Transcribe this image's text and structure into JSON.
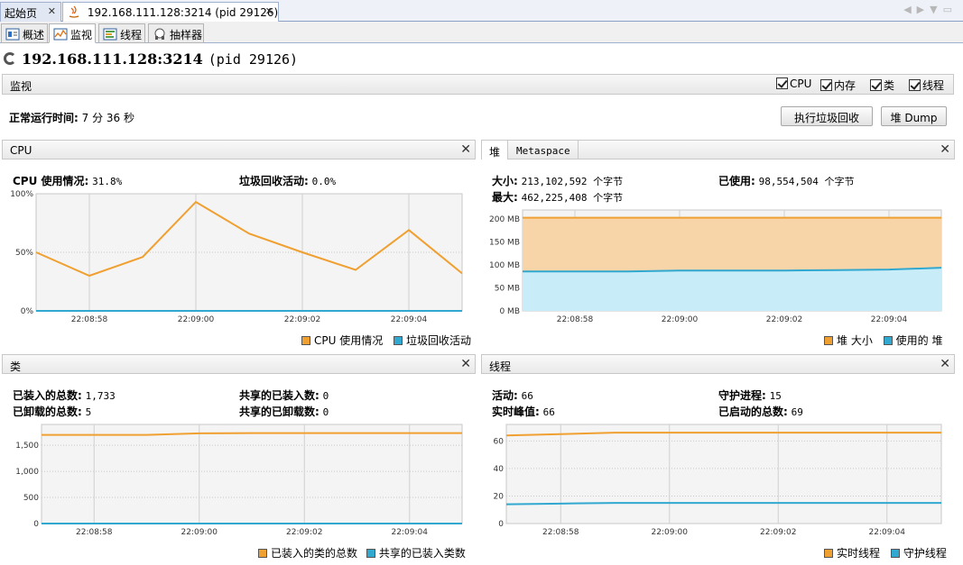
{
  "doc_tabs": [
    {
      "label": "起始页"
    },
    {
      "label": "192.168.111.128:3214 (pid 29126)"
    }
  ],
  "sub_tabs": [
    {
      "label": "概述"
    },
    {
      "label": "监视"
    },
    {
      "label": "线程"
    },
    {
      "label": "抽样器"
    }
  ],
  "header": {
    "host": "192.168.111.128:3214",
    "pid": "(pid 29126)"
  },
  "monitor": {
    "title": "监视",
    "checkboxes": [
      "CPU",
      "内存",
      "类",
      "线程"
    ],
    "uptime_label": "正常运行时间:",
    "uptime_value": "7 分 36 秒",
    "gc_button": "执行垃圾回收",
    "heap_dump_button": "堆 Dump"
  },
  "cpu_panel": {
    "title": "CPU",
    "cpu_label": "CPU 使用情况:",
    "cpu_value": "31.8%",
    "gc_label": "垃圾回收活动:",
    "gc_value": "0.0%",
    "legend": [
      "CPU 使用情况",
      "垃圾回收活动"
    ]
  },
  "heap_panel": {
    "tabs": [
      "堆",
      "Metaspace"
    ],
    "size_label": "大小:",
    "size_value": "213,102,592 个字节",
    "max_label": "最大:",
    "max_value": "462,225,408 个字节",
    "used_label": "已使用:",
    "used_value": "98,554,504 个字节",
    "legend": [
      "堆 大小",
      "使用的 堆"
    ]
  },
  "class_panel": {
    "title": "类",
    "loaded_label": "已装入的总数:",
    "loaded_value": "1,733",
    "unloaded_label": "已卸载的总数:",
    "unloaded_value": "5",
    "shared_loaded_label": "共享的已装入数:",
    "shared_loaded_value": "0",
    "shared_unloaded_label": "共享的已卸载数:",
    "shared_unloaded_value": "0",
    "legend": [
      "已装入的类的总数",
      "共享的已装入类数"
    ]
  },
  "thread_panel": {
    "title": "线程",
    "live_label": "活动:",
    "live_value": "66",
    "peak_label": "实时峰值:",
    "peak_value": "66",
    "daemon_label": "守护进程:",
    "daemon_value": "15",
    "started_label": "已启动的总数:",
    "started_value": "69",
    "legend": [
      "实时线程",
      "守护线程"
    ]
  },
  "colors": {
    "orange": "#f0a030",
    "blue": "#30a8d0",
    "orange_fill": "#f8d5a8",
    "blue_fill": "#c8ecf8"
  },
  "chart_data": [
    {
      "type": "line",
      "name": "CPU",
      "x": [
        "22:08:57",
        "22:08:58",
        "22:08:59",
        "22:09:00",
        "22:09:01",
        "22:09:02",
        "22:09:03",
        "22:09:04",
        "22:09:05"
      ],
      "xticks": [
        "22:08:58",
        "22:09:00",
        "22:09:02",
        "22:09:04"
      ],
      "yticks": [
        "0%",
        "50%",
        "100%"
      ],
      "ylim": [
        0,
        100
      ],
      "series": [
        {
          "name": "CPU 使用情况",
          "values": [
            50,
            30,
            46,
            93,
            66,
            50,
            35,
            69,
            32
          ]
        },
        {
          "name": "垃圾回收活动",
          "values": [
            0,
            0,
            0,
            0,
            0,
            0,
            0,
            0,
            0
          ]
        }
      ]
    },
    {
      "type": "area",
      "name": "Heap",
      "x": [
        "22:08:57",
        "22:08:58",
        "22:08:59",
        "22:09:00",
        "22:09:01",
        "22:09:02",
        "22:09:03",
        "22:09:04",
        "22:09:05"
      ],
      "xticks": [
        "22:08:58",
        "22:09:00",
        "22:09:02",
        "22:09:04"
      ],
      "yticks": [
        "0 MB",
        "50 MB",
        "100 MB",
        "150 MB",
        "200 MB"
      ],
      "ylim": [
        0,
        220
      ],
      "series": [
        {
          "name": "堆 大小",
          "values": [
            203,
            203,
            203,
            203,
            203,
            203,
            203,
            203,
            203
          ]
        },
        {
          "name": "使用的 堆",
          "values": [
            86,
            86,
            86,
            88,
            88,
            88,
            89,
            90,
            94
          ]
        }
      ]
    },
    {
      "type": "line",
      "name": "Classes",
      "x": [
        "22:08:57",
        "22:08:58",
        "22:08:59",
        "22:09:00",
        "22:09:01",
        "22:09:02",
        "22:09:03",
        "22:09:04",
        "22:09:05"
      ],
      "xticks": [
        "22:08:58",
        "22:09:00",
        "22:09:02",
        "22:09:04"
      ],
      "yticks": [
        "0",
        "500",
        "1,000",
        "1,500"
      ],
      "ylim": [
        0,
        1900
      ],
      "series": [
        {
          "name": "已装入的类的总数",
          "values": [
            1700,
            1700,
            1700,
            1730,
            1733,
            1733,
            1733,
            1733,
            1733
          ]
        },
        {
          "name": "共享的已装入类数",
          "values": [
            0,
            0,
            0,
            0,
            0,
            0,
            0,
            0,
            0
          ]
        }
      ]
    },
    {
      "type": "line",
      "name": "Threads",
      "x": [
        "22:08:57",
        "22:08:58",
        "22:08:59",
        "22:09:00",
        "22:09:01",
        "22:09:02",
        "22:09:03",
        "22:09:04",
        "22:09:05"
      ],
      "xticks": [
        "22:08:58",
        "22:09:00",
        "22:09:02",
        "22:09:04"
      ],
      "yticks": [
        "0",
        "20",
        "40",
        "60"
      ],
      "ylim": [
        0,
        72
      ],
      "series": [
        {
          "name": "实时线程",
          "values": [
            64,
            65,
            66,
            66,
            66,
            66,
            66,
            66,
            66
          ]
        },
        {
          "name": "守护线程",
          "values": [
            14,
            14.5,
            15,
            15,
            15,
            15,
            15,
            15,
            15
          ]
        }
      ]
    }
  ]
}
